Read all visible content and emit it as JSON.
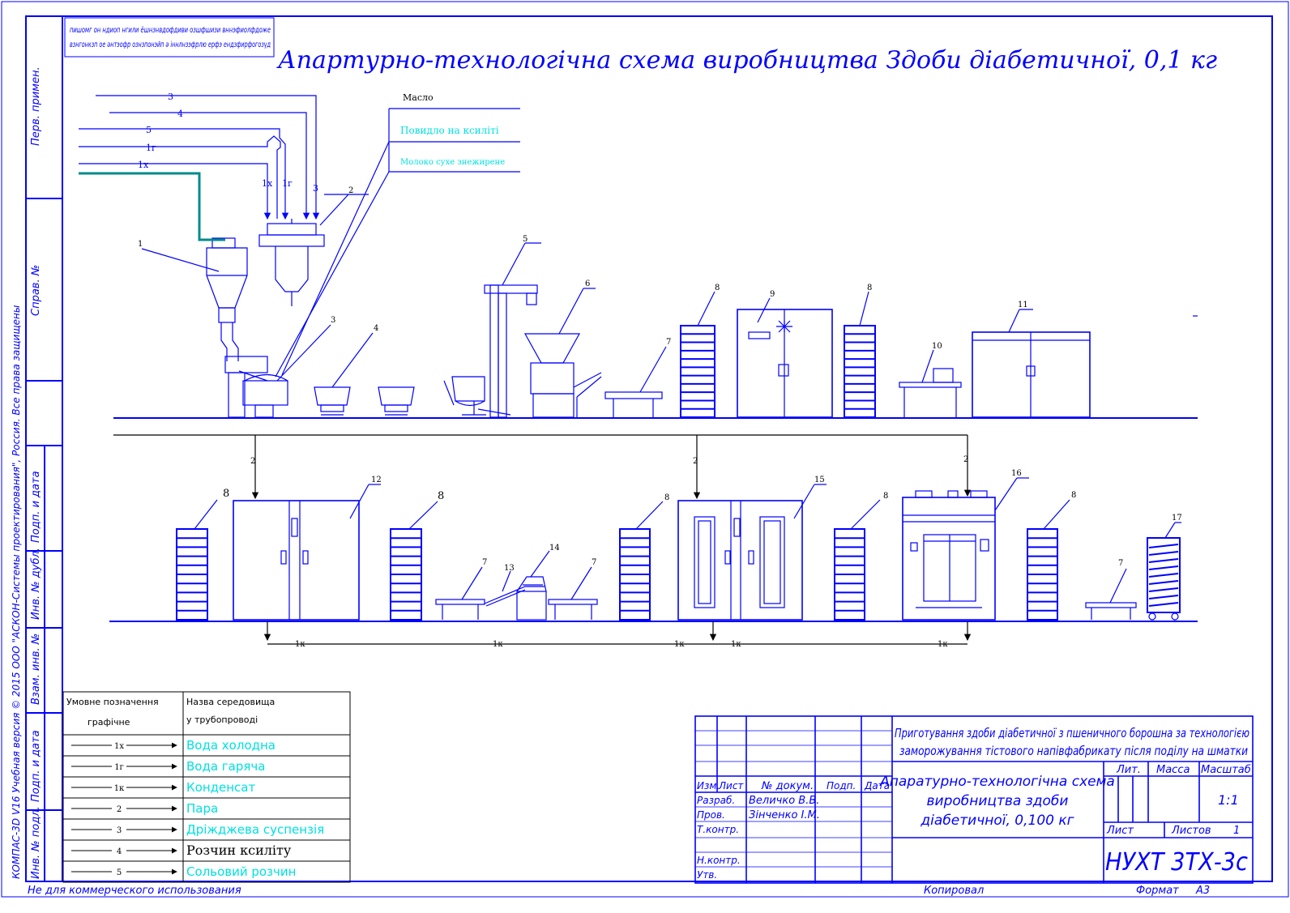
{
  "title": "Апартурно-технологічна схема виробництва Здоби діабетичної, 0,1 кг",
  "mirrored_stamp": [
    "пишомг он ндиоп нгили ёшнзнвдофдиви озшфшизи вннэфиолфдоже",
    "взнгонкзп ое әнтэофр ознзпонэйп ә іннлнзэфрлю ерфэ ендзфирфогозүд"
  ],
  "side_frame": [
    "Перв. примен.",
    "Справ. №",
    "Подп. и дата",
    "Инв. № дубл.",
    "Взам. инв. №",
    "Подп. и дата",
    "Инв. № подл."
  ],
  "side_copyright": "КОМПАС-3D V16 Учебная версия  © 2015 ООО \"АСКОН-Системы проектирования\", Россия. Все права защищены",
  "footer": {
    "left": "Не для коммерческого использования",
    "copied": "Копировал",
    "format_label": "Формат",
    "format_value": "А3"
  },
  "ingredients": {
    "oil": "Масло",
    "jam": "Повидло на ксиліті",
    "milk": "Молоко сухе знежирене"
  },
  "pipes_top": [
    "3",
    "4",
    "5",
    "1г",
    "1х"
  ],
  "pipes_drop": [
    "1х",
    "1г",
    "3"
  ],
  "equipment_labels": [
    "1",
    "2",
    "3",
    "4",
    "5",
    "6",
    "7",
    "8",
    "9",
    "8",
    "10",
    "11",
    "8",
    "12",
    "8",
    "7",
    "13",
    "14",
    "7",
    "8",
    "15",
    "8",
    "16",
    "8",
    "17",
    "7"
  ],
  "steam_labels": [
    "2",
    "2",
    "2"
  ],
  "condensate_labels": [
    "1к",
    "1к",
    "1к",
    "1к",
    "1к"
  ],
  "legend": {
    "header_symbol": "Умовне позначення",
    "header_symbol_sub": "графічне",
    "header_medium": "Назва середовища",
    "header_medium_sub": "у трубопроводі",
    "rows": [
      {
        "code": "1х",
        "name": "Вода холодна",
        "cyan": true
      },
      {
        "code": "1г",
        "name": "Вода гаряча",
        "cyan": true
      },
      {
        "code": "1к",
        "name": "Конденсат",
        "cyan": true
      },
      {
        "code": "2",
        "name": "Пара",
        "cyan": true
      },
      {
        "code": "3",
        "name": "Дріжджева суспензія",
        "cyan": true
      },
      {
        "code": "4",
        "name": "Розчин ксиліту",
        "cyan": false
      },
      {
        "code": "5",
        "name": "Сольовий розчин",
        "cyan": true
      }
    ]
  },
  "title_block": {
    "description": [
      "Приготування здоби діабетичної з пшеничного борошна за технологією",
      "заморожування тістового напівфабрикату після поділу на шматки"
    ],
    "name": [
      "Апаратурно-технологічна схема",
      "виробництва здоби",
      "діабетичної, 0,100 кг"
    ],
    "headers": [
      "Изм.",
      "Лист",
      "№ докум.",
      "Подп.",
      "Дата"
    ],
    "rows": [
      [
        "Разраб.",
        "Величко В.В."
      ],
      [
        "Пров.",
        "Зінченко І.М."
      ],
      [
        "Т.контр.",
        ""
      ],
      [
        "Н.контр.",
        ""
      ],
      [
        "Утв.",
        ""
      ]
    ],
    "lit": "Лит.",
    "mass": "Масса",
    "scale_label": "Масштаб",
    "scale": "1:1",
    "sheet": "Лист",
    "sheets": "Листов",
    "sheets_value": "1",
    "code": "НУХТ 3ТХ-3с"
  },
  "colors": {
    "line": "#0000ff",
    "cyan": "#00e0e0",
    "teal": "#008b8b",
    "black": "#000000"
  }
}
